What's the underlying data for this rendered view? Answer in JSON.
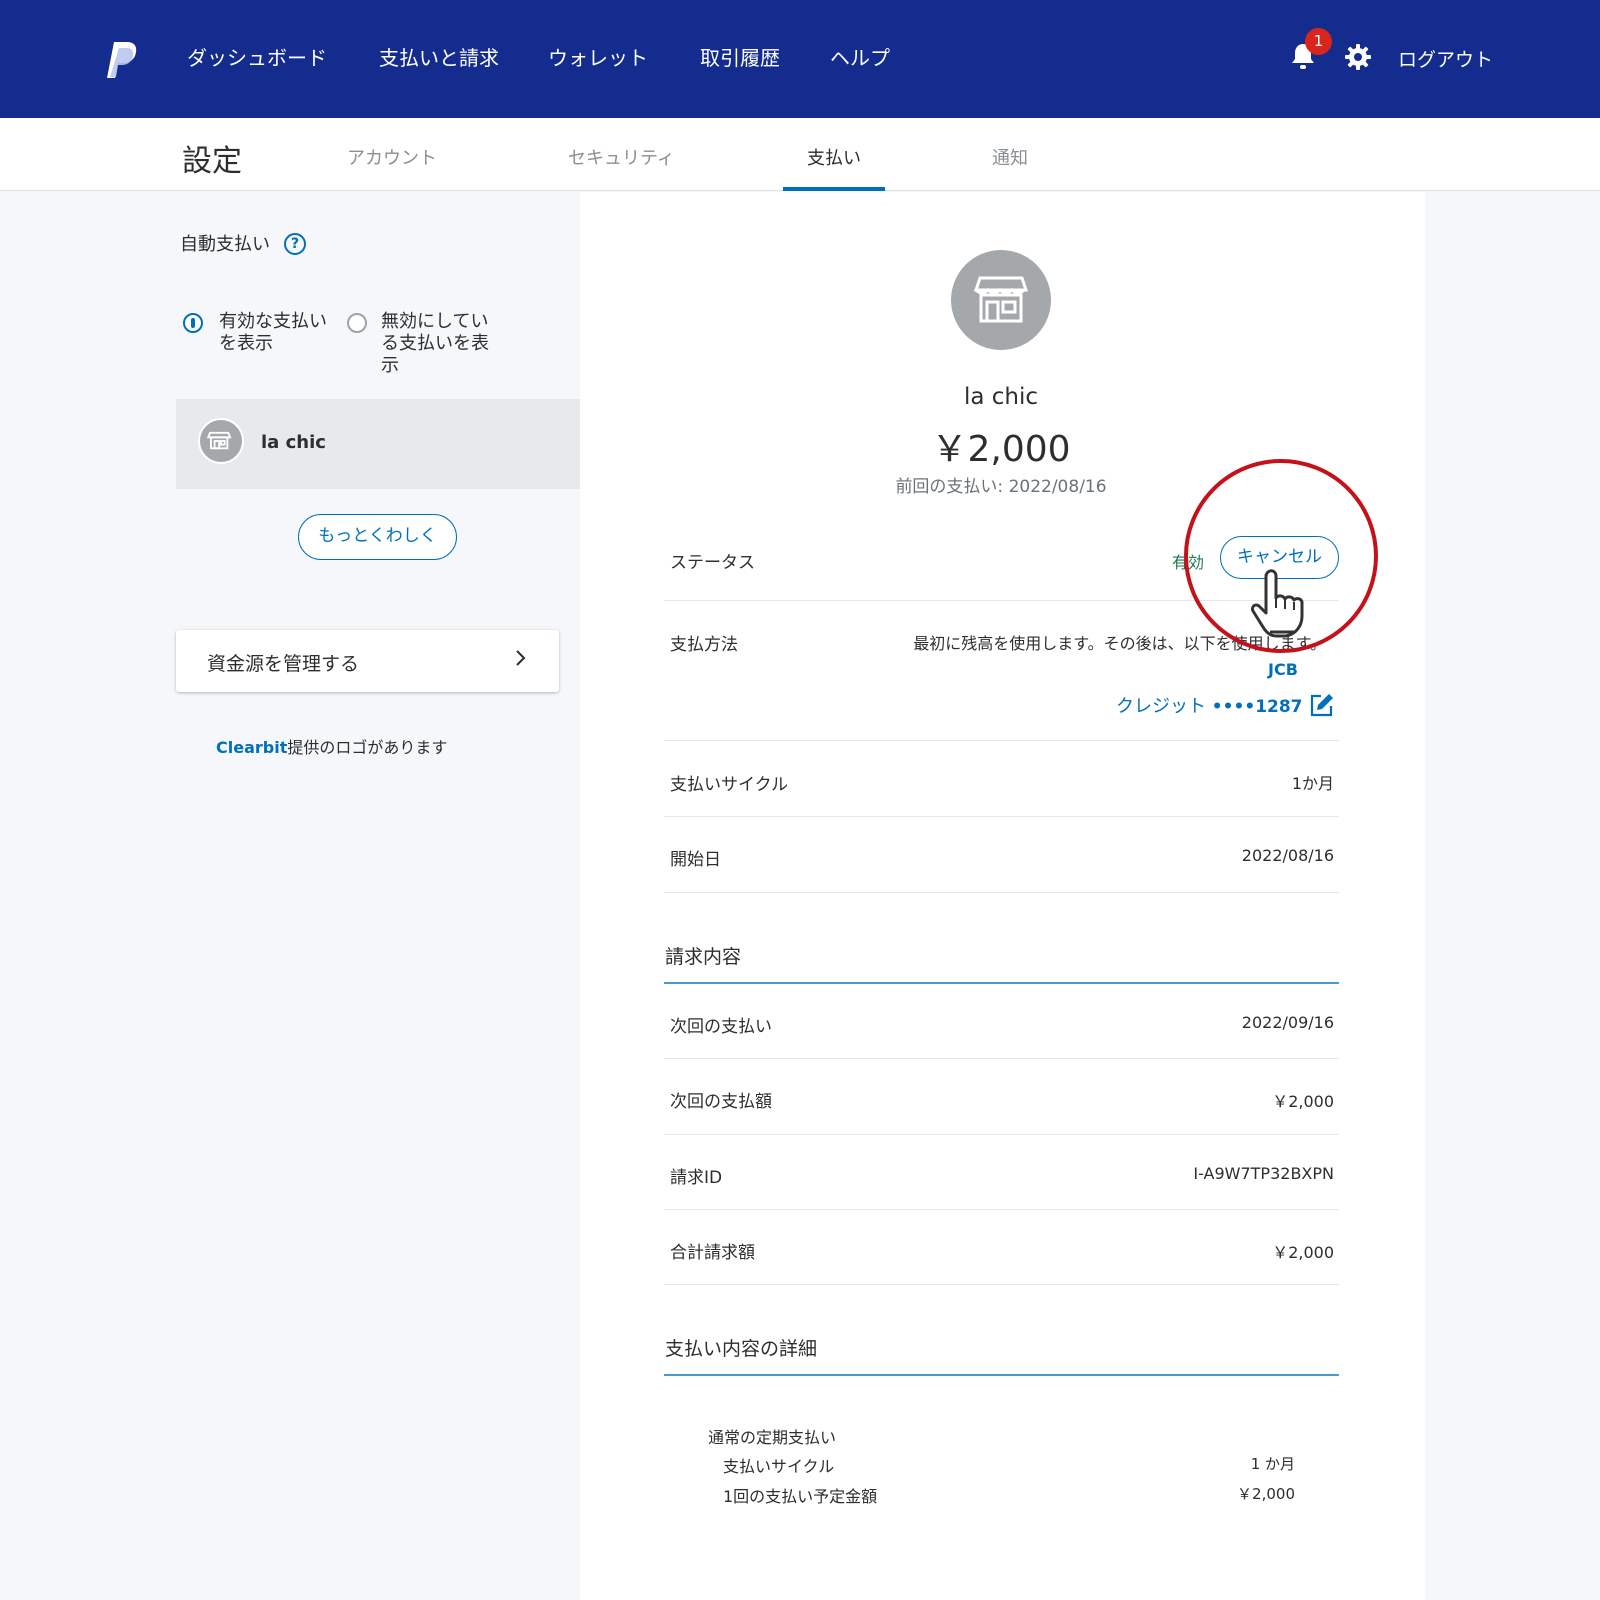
{
  "nav": {
    "items": [
      "ダッシュボード",
      "支払いと請求",
      "ウォレット",
      "取引履歴",
      "ヘルプ"
    ],
    "notification_count": "1",
    "logout": "ログアウト"
  },
  "subnav": {
    "title": "設定",
    "tabs": [
      "アカウント",
      "セキュリティ",
      "支払い",
      "通知"
    ],
    "active_tab": "支払い"
  },
  "sidebar": {
    "title": "自動支払い",
    "help": "?",
    "radio_active": "有効な支払いを表示",
    "radio_active_lines": [
      "有効な支払い",
      "を表示"
    ],
    "radio_inactive_lines": [
      "無効にしてい",
      "る支払いを表",
      "示"
    ],
    "merchant": "la chic",
    "more_button": "もっとくわしく",
    "manage_funds": "資金源を管理する",
    "clearbit_brand": "Clearbit",
    "clearbit_text": "提供のロゴがあります"
  },
  "detail": {
    "merchant": "la chic",
    "amount": "￥2,000",
    "last_payment": "前回の支払い: 2022/08/16",
    "status_label": "ステータス",
    "status_value": "有効",
    "cancel_button": "キャンセル",
    "payment_method_label": "支払方法",
    "payment_method_text": "最初に残高を使用します。その後は、以下を使用します。",
    "card_brand": "JCB",
    "card_type": "クレジット ",
    "card_number": "••••1287",
    "cycle_label": "支払いサイクル",
    "cycle_value": "1か月",
    "start_label": "開始日",
    "start_value": "2022/08/16"
  },
  "billing": {
    "title": "請求内容",
    "rows": [
      {
        "label": "次回の支払い",
        "value": "2022/09/16"
      },
      {
        "label": "次回の支払額",
        "value": "￥2,000"
      },
      {
        "label": "請求ID",
        "value": "I-A9W7TP32BXPN"
      },
      {
        "label": "合計請求額",
        "value": "￥2,000"
      }
    ]
  },
  "payment_details": {
    "title": "支払い内容の詳細",
    "heading": "通常の定期支払い",
    "rows": [
      {
        "label": "支払いサイクル",
        "value": "1 か月"
      },
      {
        "label": "1回の支払い予定金額",
        "value": "￥2,000"
      }
    ]
  },
  "colors": {
    "nav_bg": "#142c8e",
    "accent": "#0070ba",
    "annotation": "#c4111a",
    "badge": "#d9261c"
  }
}
